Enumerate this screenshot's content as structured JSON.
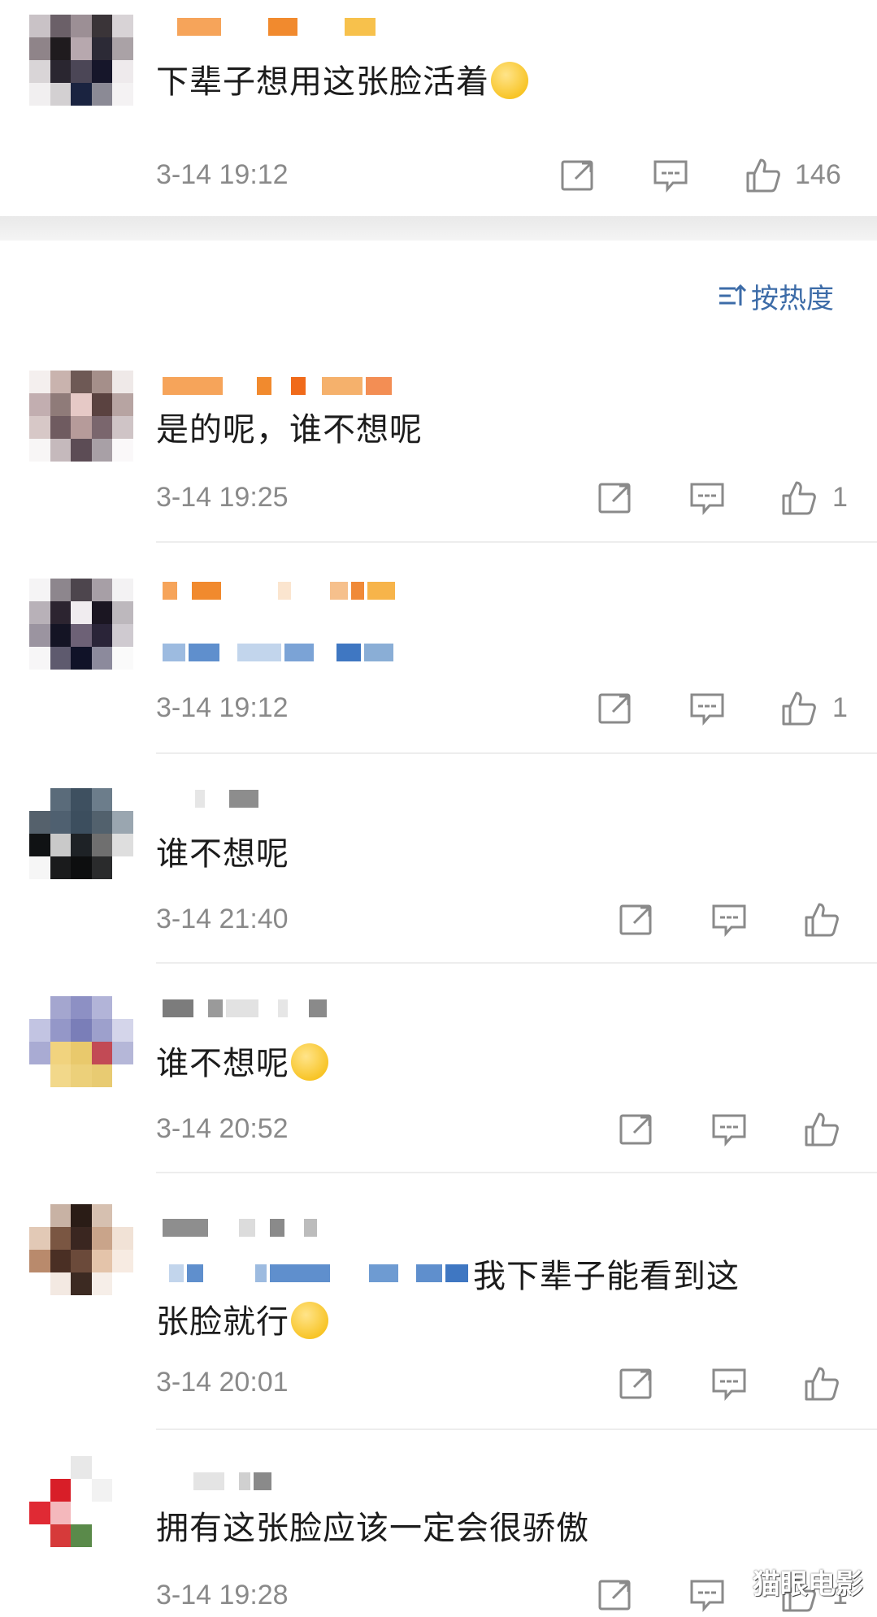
{
  "top_comment": {
    "text": "下辈子想用这张脸活着",
    "emoji": "crying-face-emoji",
    "time": "3-14 19:12",
    "likes": "146"
  },
  "sort": {
    "label": "按热度",
    "icon": "sort-icon"
  },
  "replies": [
    {
      "text": "是的呢，谁不想呢",
      "time": "3-14 19:25",
      "likes": "1"
    },
    {
      "text": "",
      "time": "3-14 19:12",
      "likes": "1"
    },
    {
      "text": "谁不想呢",
      "time": "3-14 21:40",
      "likes": ""
    },
    {
      "text": "谁不想呢",
      "emoji": "smiley-face-emoji",
      "time": "3-14 20:52",
      "likes": ""
    },
    {
      "text_line1": "我下辈子能看到这",
      "text_line2": "张脸就行",
      "emoji": "scared-face-emoji",
      "time": "3-14 20:01",
      "likes": ""
    },
    {
      "text": "拥有这张脸应该一定会很骄傲",
      "time": "3-14 19:28",
      "likes": "1"
    }
  ],
  "watermark": "猫眼电影",
  "colors": {
    "accent": "#3d6ca8",
    "text": "#1c1c1c",
    "meta": "#8a8a8a",
    "orange_blur": "#f6a45a",
    "blue_blur": "#8aaed6"
  }
}
